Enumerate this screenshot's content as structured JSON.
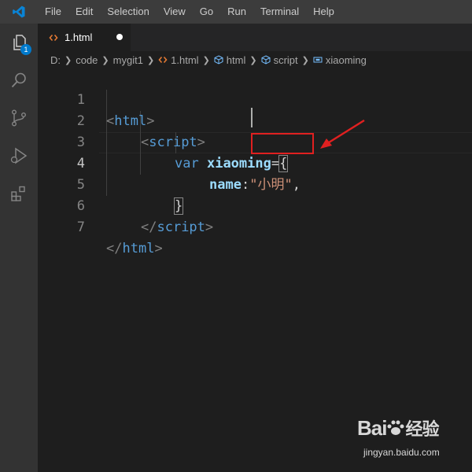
{
  "menu": [
    "File",
    "Edit",
    "Selection",
    "View",
    "Go",
    "Run",
    "Terminal",
    "Help"
  ],
  "activity": {
    "explorer_badge": "1"
  },
  "tab": {
    "filename": "1.html"
  },
  "breadcrumb": {
    "drive": "D:",
    "folder1": "code",
    "folder2": "mygit1",
    "file": "1.html",
    "sym1": "html",
    "sym2": "script",
    "sym3": "xiaoming"
  },
  "editor": {
    "line_numbers": [
      "1",
      "2",
      "3",
      "4",
      "5",
      "6",
      "7"
    ],
    "tokens": {
      "l1_lt": "<",
      "l1_tag": "html",
      "l1_gt": ">",
      "l2_lt": "<",
      "l2_tag": "script",
      "l2_gt": ">",
      "l3_kw": "var",
      "l3_var": "xiaoming",
      "l3_eq": "=",
      "l3_brace": "{",
      "l4_prop": "name",
      "l4_colon": ":",
      "l4_str": "\"小明\"",
      "l4_comma": ",",
      "l5_brace": "}",
      "l6_lt": "</",
      "l6_tag": "script",
      "l6_gt": ">",
      "l7_lt": "</",
      "l7_tag": "html",
      "l7_gt": ">"
    }
  },
  "watermark": {
    "brand": "Bai",
    "brand2": "经验",
    "url": "jingyan.baidu.com"
  },
  "colors": {
    "accent": "#007acc",
    "annotation": "#e02020"
  }
}
